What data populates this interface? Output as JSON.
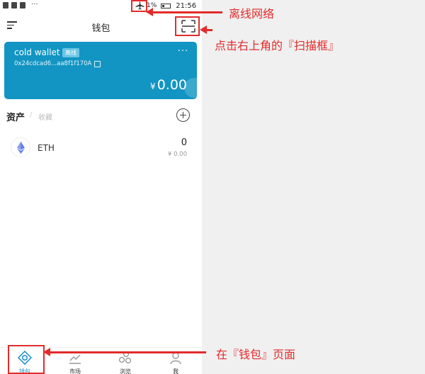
{
  "status_bar": {
    "battery_text": "1%",
    "time": "21:56",
    "dots": "···"
  },
  "header": {
    "title": "钱包"
  },
  "wallet_card": {
    "name": "cold wallet",
    "badge": "离线",
    "more": "···",
    "address": "0x24cdcad6...aa8f1f170A",
    "currency_symbol": "¥",
    "balance": "0.00",
    "color": "#1295c3"
  },
  "assets": {
    "tab_active": "资产",
    "separator": "/",
    "tab_inactive": "收藏",
    "items": [
      {
        "icon": "eth-icon",
        "name": "ETH",
        "amount": "0",
        "value": "¥ 0.00"
      }
    ]
  },
  "bottom_nav": {
    "items": [
      {
        "icon": "wallet-icon",
        "label": "钱包",
        "active": true
      },
      {
        "icon": "market-icon",
        "label": "市场",
        "active": false
      },
      {
        "icon": "browse-icon",
        "label": "浏览",
        "active": false
      },
      {
        "icon": "me-icon",
        "label": "我",
        "active": false
      }
    ]
  },
  "annotations": {
    "offline_note": "离线网络",
    "scan_note": "点击右上角的『扫描框』",
    "wallet_page_note": "在『钱包』页面",
    "color": "#e32b2b"
  }
}
